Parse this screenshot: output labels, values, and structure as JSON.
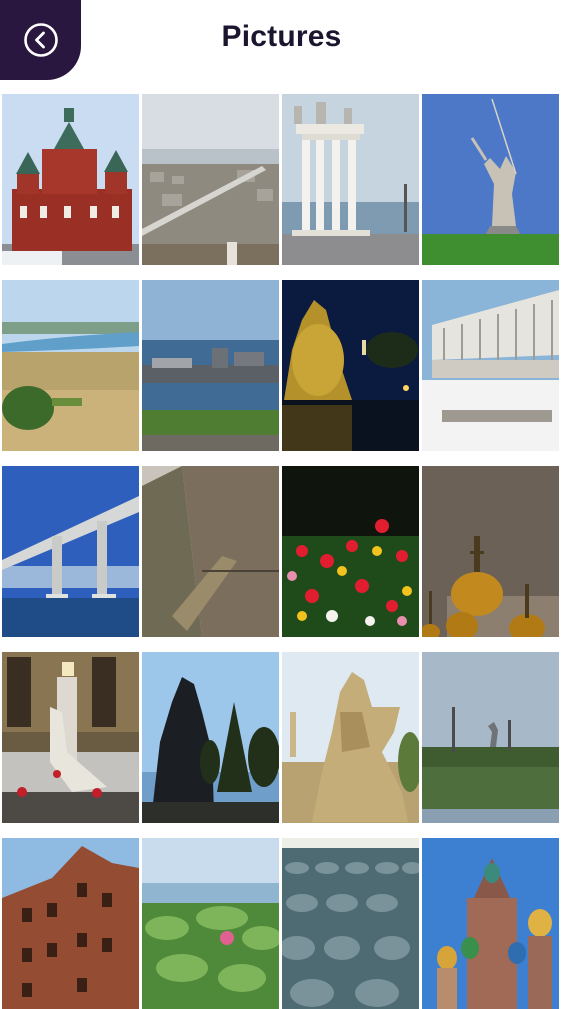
{
  "header": {
    "title": "Pictures",
    "back_icon": "chevron-left-circle-icon",
    "accent_color": "#2a1740"
  },
  "gallery": {
    "items": [
      {
        "name": "photo-red-church"
      },
      {
        "name": "photo-city-bridge-aerial"
      },
      {
        "name": "photo-colonnade"
      },
      {
        "name": "photo-motherland-statue"
      },
      {
        "name": "photo-river-valley"
      },
      {
        "name": "photo-river-harbor"
      },
      {
        "name": "photo-night-statue"
      },
      {
        "name": "photo-modern-building"
      },
      {
        "name": "photo-highway-bridge"
      },
      {
        "name": "photo-river-aerial"
      },
      {
        "name": "photo-flowers-night"
      },
      {
        "name": "photo-golden-domes"
      },
      {
        "name": "photo-memorial-hand"
      },
      {
        "name": "photo-silhouette-statue"
      },
      {
        "name": "photo-soldier-sculpture"
      },
      {
        "name": "photo-distant-statue"
      },
      {
        "name": "photo-ruined-mill"
      },
      {
        "name": "photo-lotus-pond"
      },
      {
        "name": "photo-cabbage-field"
      },
      {
        "name": "photo-onion-dome-church"
      }
    ]
  }
}
